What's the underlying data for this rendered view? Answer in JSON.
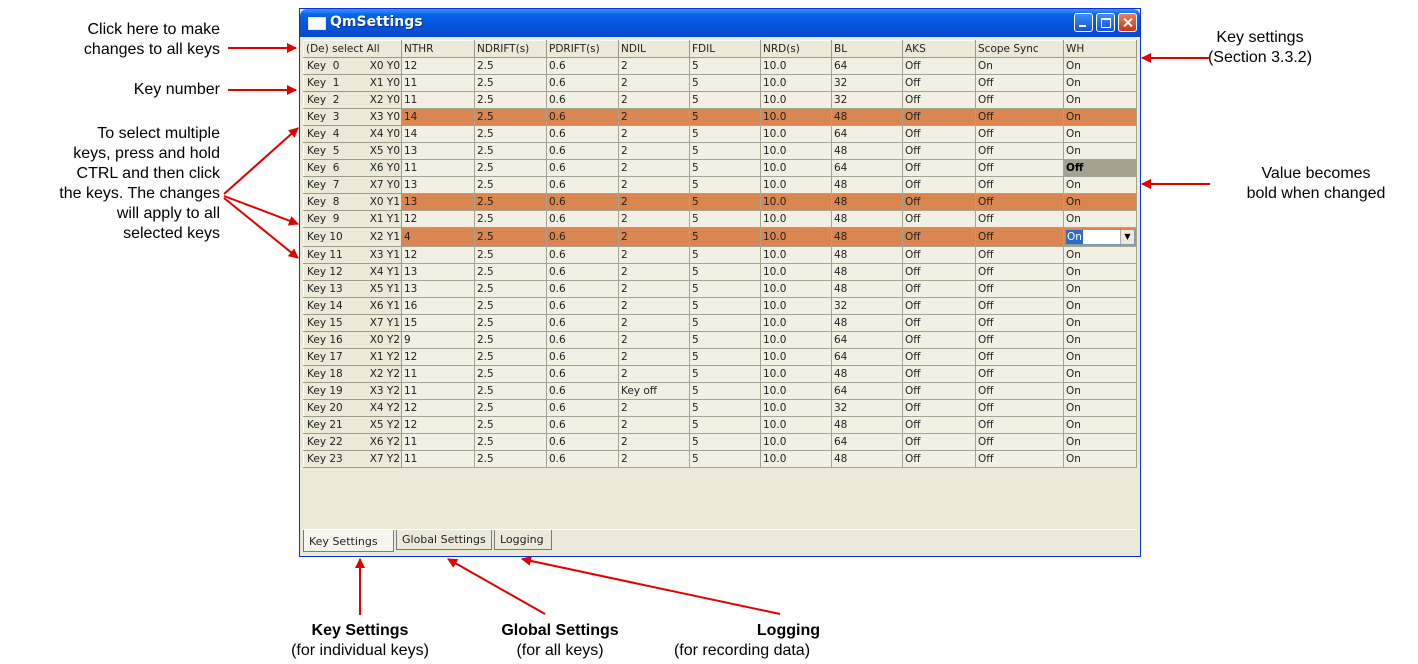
{
  "window": {
    "title": "QmSettings"
  },
  "grid": {
    "select_all": "(De) select All",
    "columns": [
      "NTHR",
      "NDRIFT(s)",
      "PDRIFT(s)",
      "NDIL",
      "FDIL",
      "NRD(s)",
      "BL",
      "AKS",
      "Scope Sync",
      "WH"
    ],
    "rows": [
      {
        "key": "Key  0",
        "pos": "X0 Y0",
        "cells": [
          "12",
          "2.5",
          "0.6",
          "2",
          "5",
          "10.0",
          "64",
          "Off",
          "On",
          "On"
        ]
      },
      {
        "key": "Key  1",
        "pos": "X1 Y0",
        "cells": [
          "11",
          "2.5",
          "0.6",
          "2",
          "5",
          "10.0",
          "32",
          "Off",
          "Off",
          "On"
        ]
      },
      {
        "key": "Key  2",
        "pos": "X2 Y0",
        "cells": [
          "11",
          "2.5",
          "0.6",
          "2",
          "5",
          "10.0",
          "32",
          "Off",
          "Off",
          "On"
        ]
      },
      {
        "key": "Key  3",
        "pos": "X3 Y0",
        "cells": [
          "14",
          "2.5",
          "0.6",
          "2",
          "5",
          "10.0",
          "48",
          "Off",
          "Off",
          "On"
        ]
      },
      {
        "key": "Key  4",
        "pos": "X4 Y0",
        "cells": [
          "14",
          "2.5",
          "0.6",
          "2",
          "5",
          "10.0",
          "64",
          "Off",
          "Off",
          "On"
        ]
      },
      {
        "key": "Key  5",
        "pos": "X5 Y0",
        "cells": [
          "13",
          "2.5",
          "0.6",
          "2",
          "5",
          "10.0",
          "48",
          "Off",
          "Off",
          "On"
        ]
      },
      {
        "key": "Key  6",
        "pos": "X6 Y0",
        "cells": [
          "11",
          "2.5",
          "0.6",
          "2",
          "5",
          "10.0",
          "64",
          "Off",
          "Off",
          "Off"
        ]
      },
      {
        "key": "Key  7",
        "pos": "X7 Y0",
        "cells": [
          "13",
          "2.5",
          "0.6",
          "2",
          "5",
          "10.0",
          "48",
          "Off",
          "Off",
          "On"
        ]
      },
      {
        "key": "Key  8",
        "pos": "X0 Y1",
        "cells": [
          "13",
          "2.5",
          "0.6",
          "2",
          "5",
          "10.0",
          "48",
          "Off",
          "Off",
          "On"
        ]
      },
      {
        "key": "Key  9",
        "pos": "X1 Y1",
        "cells": [
          "12",
          "2.5",
          "0.6",
          "2",
          "5",
          "10.0",
          "48",
          "Off",
          "Off",
          "On"
        ]
      },
      {
        "key": "Key 10",
        "pos": "X2 Y1",
        "cells": [
          "4",
          "2.5",
          "0.6",
          "2",
          "5",
          "10.0",
          "48",
          "Off",
          "Off",
          "On"
        ]
      },
      {
        "key": "Key 11",
        "pos": "X3 Y1",
        "cells": [
          "12",
          "2.5",
          "0.6",
          "2",
          "5",
          "10.0",
          "48",
          "Off",
          "Off",
          "On"
        ]
      },
      {
        "key": "Key 12",
        "pos": "X4 Y1",
        "cells": [
          "13",
          "2.5",
          "0.6",
          "2",
          "5",
          "10.0",
          "48",
          "Off",
          "Off",
          "On"
        ]
      },
      {
        "key": "Key 13",
        "pos": "X5 Y1",
        "cells": [
          "13",
          "2.5",
          "0.6",
          "2",
          "5",
          "10.0",
          "48",
          "Off",
          "Off",
          "On"
        ]
      },
      {
        "key": "Key 14",
        "pos": "X6 Y1",
        "cells": [
          "16",
          "2.5",
          "0.6",
          "2",
          "5",
          "10.0",
          "32",
          "Off",
          "Off",
          "On"
        ]
      },
      {
        "key": "Key 15",
        "pos": "X7 Y1",
        "cells": [
          "15",
          "2.5",
          "0.6",
          "2",
          "5",
          "10.0",
          "48",
          "Off",
          "Off",
          "On"
        ]
      },
      {
        "key": "Key 16",
        "pos": "X0 Y2",
        "cells": [
          "9",
          "2.5",
          "0.6",
          "2",
          "5",
          "10.0",
          "64",
          "Off",
          "Off",
          "On"
        ]
      },
      {
        "key": "Key 17",
        "pos": "X1 Y2",
        "cells": [
          "12",
          "2.5",
          "0.6",
          "2",
          "5",
          "10.0",
          "64",
          "Off",
          "Off",
          "On"
        ]
      },
      {
        "key": "Key 18",
        "pos": "X2 Y2",
        "cells": [
          "11",
          "2.5",
          "0.6",
          "2",
          "5",
          "10.0",
          "48",
          "Off",
          "Off",
          "On"
        ]
      },
      {
        "key": "Key 19",
        "pos": "X3 Y2",
        "cells": [
          "11",
          "2.5",
          "0.6",
          "Key off",
          "5",
          "10.0",
          "64",
          "Off",
          "Off",
          "On"
        ]
      },
      {
        "key": "Key 20",
        "pos": "X4 Y2",
        "cells": [
          "12",
          "2.5",
          "0.6",
          "2",
          "5",
          "10.0",
          "32",
          "Off",
          "Off",
          "On"
        ]
      },
      {
        "key": "Key 21",
        "pos": "X5 Y2",
        "cells": [
          "12",
          "2.5",
          "0.6",
          "2",
          "5",
          "10.0",
          "48",
          "Off",
          "Off",
          "On"
        ]
      },
      {
        "key": "Key 22",
        "pos": "X6 Y2",
        "cells": [
          "11",
          "2.5",
          "0.6",
          "2",
          "5",
          "10.0",
          "64",
          "Off",
          "Off",
          "On"
        ]
      },
      {
        "key": "Key 23",
        "pos": "X7 Y2",
        "cells": [
          "11",
          "2.5",
          "0.6",
          "2",
          "5",
          "10.0",
          "48",
          "Off",
          "Off",
          "On"
        ]
      }
    ],
    "selected_rows": [
      3,
      8,
      10
    ],
    "changed_cell": {
      "row": 6,
      "col": 9
    },
    "editing_cell": {
      "row": 10,
      "col": 9,
      "value": "On"
    }
  },
  "tabs": [
    "Key Settings",
    "Global Settings",
    "Logging"
  ],
  "active_tab": "Key Settings",
  "colors": {
    "selected_row": "#d98650",
    "changed_cell": "#a6a292",
    "arrow": "#e00000"
  },
  "annotations": {
    "click_all": [
      "Click here to make",
      "changes to all keys"
    ],
    "key_number": "Key number",
    "multi_select": [
      "To select multiple",
      "keys, press and hold",
      "CTRL and then click",
      "the keys. The changes",
      "will apply to all",
      "selected keys"
    ],
    "key_settings_right": [
      "Key settings",
      "(Section 3.3.2)"
    ],
    "bold_changed": [
      "Value becomes",
      "bold when changed"
    ],
    "key_settings_tab": {
      "title": "Key Settings",
      "sub": "(for individual keys)"
    },
    "global_settings_tab": {
      "title": "Global Settings",
      "sub": "(for all keys)"
    },
    "logging_tab": {
      "title": "Logging",
      "sub": "(for recording data)"
    }
  }
}
